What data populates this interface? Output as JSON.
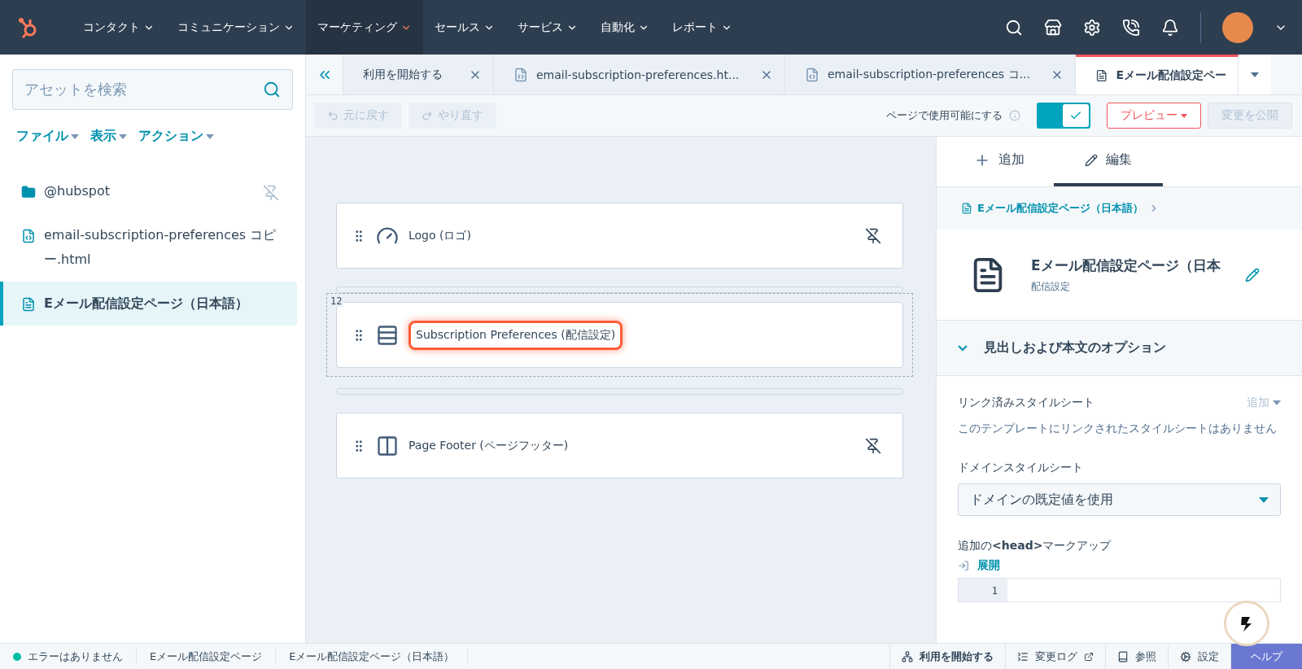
{
  "nav": {
    "items": [
      {
        "label": "コンタクト",
        "selected": false
      },
      {
        "label": "コミュニケーション",
        "selected": false
      },
      {
        "label": "マーケティング",
        "selected": true
      },
      {
        "label": "セールス",
        "selected": false
      },
      {
        "label": "サービス",
        "selected": false
      },
      {
        "label": "自動化",
        "selected": false
      },
      {
        "label": "レポート",
        "selected": false
      }
    ]
  },
  "sidebar": {
    "search": {
      "placeholder": "アセットを検索"
    },
    "menus": [
      "ファイル",
      "表示",
      "アクション"
    ],
    "items": [
      {
        "kind": "folder",
        "label": "@hubspot",
        "selected": false,
        "pinned": true
      },
      {
        "kind": "code",
        "label": "email-subscription-preferences コピー.html",
        "selected": false,
        "pinned": false
      },
      {
        "kind": "page",
        "label": "Eメール配信設定ページ（日本語）",
        "selected": true,
        "pinned": false
      }
    ]
  },
  "tabs": [
    {
      "label": "利用を開始する",
      "selected": false,
      "kind": "plain"
    },
    {
      "label": "email-subscription-preferences.ht...",
      "selected": false,
      "kind": "code"
    },
    {
      "label": "email-subscription-preferences コ...",
      "selected": false,
      "kind": "code"
    },
    {
      "label": "Eメール配信設定ペー",
      "selected": true,
      "kind": "page"
    }
  ],
  "toolbar": {
    "undo": "元に戻す",
    "redo": "やり直す",
    "availability": "ページで使用可能にする",
    "available": true,
    "preview": "プレビュー",
    "publish": "変更を公開",
    "publish_disabled": true
  },
  "canvas": {
    "modules": [
      {
        "kind": "logo",
        "label": "Logo (ロゴ)",
        "highlighted": false,
        "pinned": true
      },
      {
        "kind": "section",
        "label": "Subscription Preferences (配信設定)",
        "highlighted": true,
        "pinned": false,
        "row": "12"
      },
      {
        "kind": "footer",
        "label": "Page Footer (ページフッター)",
        "highlighted": false,
        "pinned": true
      }
    ]
  },
  "panel": {
    "tabs": [
      {
        "kind": "add",
        "label": "追加",
        "selected": false
      },
      {
        "kind": "edit",
        "label": "編集",
        "selected": true
      }
    ],
    "breadcrumb": "Eメール配信設定ページ（日本語）",
    "title": "Eメール配信設定ページ（日本",
    "subtitle": "配信設定",
    "section": {
      "title": "見出しおよび本文のオプション",
      "expanded": true
    },
    "linked_label": "リンク済みスタイルシート",
    "linked_add": "追加",
    "linked_empty": "このテンプレートにリンクされたスタイルシートはありません",
    "domain_label": "ドメインスタイルシート",
    "domain_value": "ドメインの既定値を使用",
    "head_label": "追加の**<head>**マークアップ",
    "expand": "展開",
    "line_number": "1"
  },
  "status_bar": {
    "left": [
      {
        "label": "エラーはありません",
        "color": "#00bda5"
      },
      {
        "label": "Eメール配信設定ページ"
      },
      {
        "label": "Eメール配信設定ページ（日本語）"
      }
    ],
    "right": [
      {
        "kind": "start",
        "label": "利用を開始する"
      },
      {
        "kind": "log",
        "label": "変更ログ"
      },
      {
        "kind": "ref",
        "label": "参照"
      },
      {
        "kind": "settings",
        "label": "設定"
      },
      {
        "kind": "help",
        "label": "ヘルプ"
      }
    ]
  }
}
